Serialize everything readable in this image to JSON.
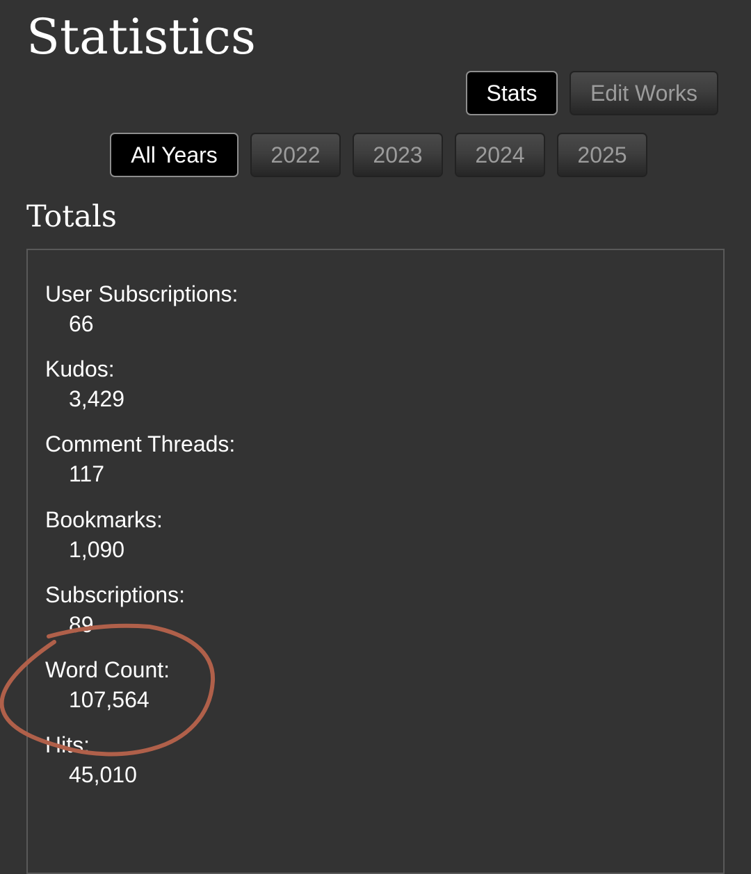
{
  "page": {
    "title": "Statistics"
  },
  "view_toggle": {
    "stats_label": "Stats",
    "edit_works_label": "Edit Works"
  },
  "year_filters": [
    {
      "label": "All Years",
      "active": true
    },
    {
      "label": "2022",
      "active": false
    },
    {
      "label": "2023",
      "active": false
    },
    {
      "label": "2024",
      "active": false
    },
    {
      "label": "2025",
      "active": false
    }
  ],
  "totals": {
    "heading": "Totals",
    "items": [
      {
        "label": "User Subscriptions:",
        "value": "66"
      },
      {
        "label": "Kudos:",
        "value": "3,429"
      },
      {
        "label": "Comment Threads:",
        "value": "117"
      },
      {
        "label": "Bookmarks:",
        "value": "1,090"
      },
      {
        "label": "Subscriptions:",
        "value": "89"
      },
      {
        "label": "Word Count:",
        "value": "107,564"
      },
      {
        "label": "Hits:",
        "value": "45,010"
      }
    ]
  },
  "annotation": {
    "highlighted_item": "Word Count:",
    "color": "#b0604a"
  },
  "colors": {
    "background": "#333333",
    "active_button_bg": "#000000",
    "inactive_button_text": "#9c9c9c",
    "box_border": "#595959"
  }
}
